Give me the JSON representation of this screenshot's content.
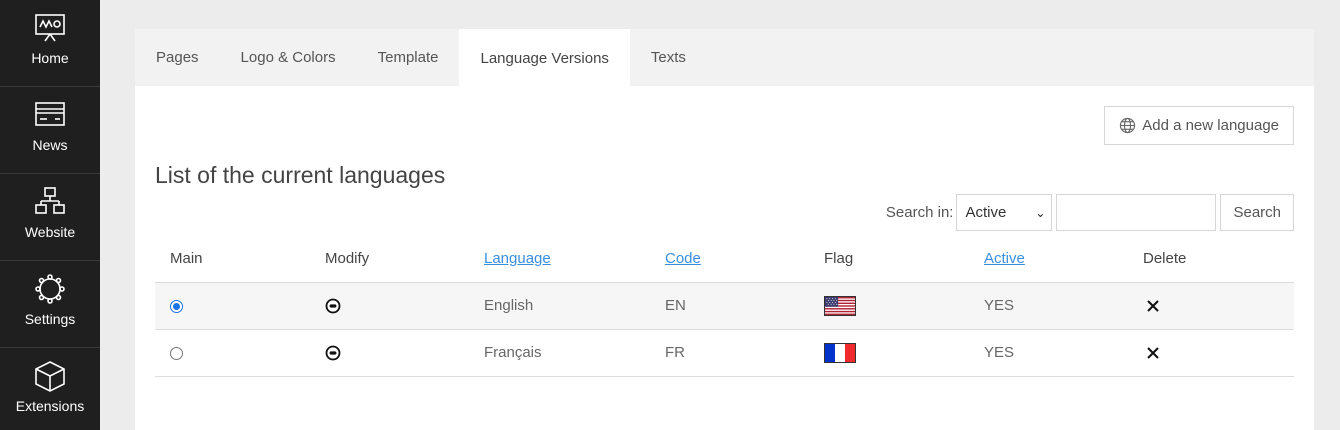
{
  "sidebar": {
    "items": [
      {
        "label": "Home",
        "icon": "presentation-board-icon"
      },
      {
        "label": "News",
        "icon": "news-card-icon"
      },
      {
        "label": "Website",
        "icon": "sitemap-icon"
      },
      {
        "label": "Settings",
        "icon": "gear-icon"
      },
      {
        "label": "Extensions",
        "icon": "cube-icon"
      }
    ]
  },
  "tabs": [
    {
      "label": "Pages"
    },
    {
      "label": "Logo & Colors"
    },
    {
      "label": "Template"
    },
    {
      "label": "Language Versions",
      "active": true
    },
    {
      "label": "Texts"
    }
  ],
  "main": {
    "add_button": "Add a new language",
    "title": "List of the current languages",
    "search": {
      "label": "Search in:",
      "selected": "Active",
      "input_value": "",
      "button": "Search"
    },
    "table": {
      "headers": [
        "Main",
        "Modify",
        "Language",
        "Code",
        "Flag",
        "Active",
        "Delete"
      ],
      "rows": [
        {
          "main": true,
          "language": "English",
          "code": "EN",
          "flag": "us-flag",
          "active": "YES"
        },
        {
          "main": false,
          "language": "Français",
          "code": "FR",
          "flag": "fr-flag",
          "active": "YES"
        }
      ]
    }
  },
  "colors": {
    "sidebar_bg": "#1f1f1f",
    "link": "#3a8ee0",
    "radio_accent": "#1a73e8"
  }
}
